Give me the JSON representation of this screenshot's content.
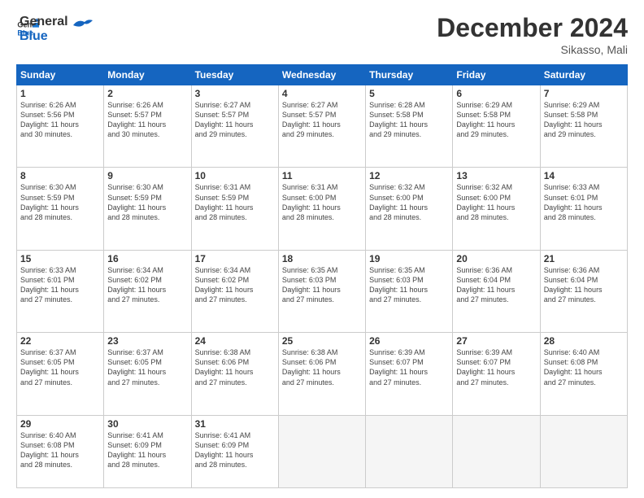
{
  "logo": {
    "text_general": "General",
    "text_blue": "Blue"
  },
  "header": {
    "month": "December 2024",
    "location": "Sikasso, Mali"
  },
  "weekdays": [
    "Sunday",
    "Monday",
    "Tuesday",
    "Wednesday",
    "Thursday",
    "Friday",
    "Saturday"
  ],
  "weeks": [
    [
      {
        "day": "1",
        "sunrise": "6:26 AM",
        "sunset": "5:56 PM",
        "daylight": "11 hours and 30 minutes."
      },
      {
        "day": "2",
        "sunrise": "6:26 AM",
        "sunset": "5:57 PM",
        "daylight": "11 hours and 30 minutes."
      },
      {
        "day": "3",
        "sunrise": "6:27 AM",
        "sunset": "5:57 PM",
        "daylight": "11 hours and 29 minutes."
      },
      {
        "day": "4",
        "sunrise": "6:27 AM",
        "sunset": "5:57 PM",
        "daylight": "11 hours and 29 minutes."
      },
      {
        "day": "5",
        "sunrise": "6:28 AM",
        "sunset": "5:58 PM",
        "daylight": "11 hours and 29 minutes."
      },
      {
        "day": "6",
        "sunrise": "6:29 AM",
        "sunset": "5:58 PM",
        "daylight": "11 hours and 29 minutes."
      },
      {
        "day": "7",
        "sunrise": "6:29 AM",
        "sunset": "5:58 PM",
        "daylight": "11 hours and 29 minutes."
      }
    ],
    [
      {
        "day": "8",
        "sunrise": "6:30 AM",
        "sunset": "5:59 PM",
        "daylight": "11 hours and 28 minutes."
      },
      {
        "day": "9",
        "sunrise": "6:30 AM",
        "sunset": "5:59 PM",
        "daylight": "11 hours and 28 minutes."
      },
      {
        "day": "10",
        "sunrise": "6:31 AM",
        "sunset": "5:59 PM",
        "daylight": "11 hours and 28 minutes."
      },
      {
        "day": "11",
        "sunrise": "6:31 AM",
        "sunset": "6:00 PM",
        "daylight": "11 hours and 28 minutes."
      },
      {
        "day": "12",
        "sunrise": "6:32 AM",
        "sunset": "6:00 PM",
        "daylight": "11 hours and 28 minutes."
      },
      {
        "day": "13",
        "sunrise": "6:32 AM",
        "sunset": "6:00 PM",
        "daylight": "11 hours and 28 minutes."
      },
      {
        "day": "14",
        "sunrise": "6:33 AM",
        "sunset": "6:01 PM",
        "daylight": "11 hours and 28 minutes."
      }
    ],
    [
      {
        "day": "15",
        "sunrise": "6:33 AM",
        "sunset": "6:01 PM",
        "daylight": "11 hours and 27 minutes."
      },
      {
        "day": "16",
        "sunrise": "6:34 AM",
        "sunset": "6:02 PM",
        "daylight": "11 hours and 27 minutes."
      },
      {
        "day": "17",
        "sunrise": "6:34 AM",
        "sunset": "6:02 PM",
        "daylight": "11 hours and 27 minutes."
      },
      {
        "day": "18",
        "sunrise": "6:35 AM",
        "sunset": "6:03 PM",
        "daylight": "11 hours and 27 minutes."
      },
      {
        "day": "19",
        "sunrise": "6:35 AM",
        "sunset": "6:03 PM",
        "daylight": "11 hours and 27 minutes."
      },
      {
        "day": "20",
        "sunrise": "6:36 AM",
        "sunset": "6:04 PM",
        "daylight": "11 hours and 27 minutes."
      },
      {
        "day": "21",
        "sunrise": "6:36 AM",
        "sunset": "6:04 PM",
        "daylight": "11 hours and 27 minutes."
      }
    ],
    [
      {
        "day": "22",
        "sunrise": "6:37 AM",
        "sunset": "6:05 PM",
        "daylight": "11 hours and 27 minutes."
      },
      {
        "day": "23",
        "sunrise": "6:37 AM",
        "sunset": "6:05 PM",
        "daylight": "11 hours and 27 minutes."
      },
      {
        "day": "24",
        "sunrise": "6:38 AM",
        "sunset": "6:06 PM",
        "daylight": "11 hours and 27 minutes."
      },
      {
        "day": "25",
        "sunrise": "6:38 AM",
        "sunset": "6:06 PM",
        "daylight": "11 hours and 27 minutes."
      },
      {
        "day": "26",
        "sunrise": "6:39 AM",
        "sunset": "6:07 PM",
        "daylight": "11 hours and 27 minutes."
      },
      {
        "day": "27",
        "sunrise": "6:39 AM",
        "sunset": "6:07 PM",
        "daylight": "11 hours and 27 minutes."
      },
      {
        "day": "28",
        "sunrise": "6:40 AM",
        "sunset": "6:08 PM",
        "daylight": "11 hours and 27 minutes."
      }
    ],
    [
      {
        "day": "29",
        "sunrise": "6:40 AM",
        "sunset": "6:08 PM",
        "daylight": "11 hours and 28 minutes."
      },
      {
        "day": "30",
        "sunrise": "6:41 AM",
        "sunset": "6:09 PM",
        "daylight": "11 hours and 28 minutes."
      },
      {
        "day": "31",
        "sunrise": "6:41 AM",
        "sunset": "6:09 PM",
        "daylight": "11 hours and 28 minutes."
      },
      null,
      null,
      null,
      null
    ]
  ],
  "labels": {
    "sunrise": "Sunrise:",
    "sunset": "Sunset:",
    "daylight": "Daylight:"
  }
}
